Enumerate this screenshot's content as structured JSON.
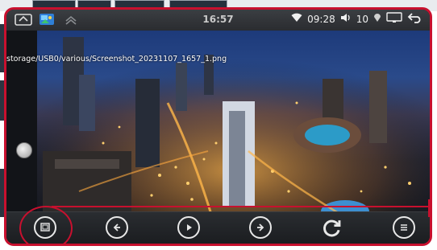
{
  "status_bar": {
    "center_time": "16:57",
    "time": "09:28",
    "volume": "10"
  },
  "viewer": {
    "file_path": "storage/USB0/various/Screenshot_20231107_1657_1.png"
  },
  "colors": {
    "annotation_red": "#c8102e",
    "toolbar_bg": "#1f2226"
  },
  "toolbar": {
    "buttons": [
      {
        "icon": "gallery-icon"
      },
      {
        "icon": "previous-icon"
      },
      {
        "icon": "play-icon"
      },
      {
        "icon": "next-icon"
      },
      {
        "icon": "rotate-icon"
      },
      {
        "icon": "menu-list-icon"
      }
    ]
  }
}
